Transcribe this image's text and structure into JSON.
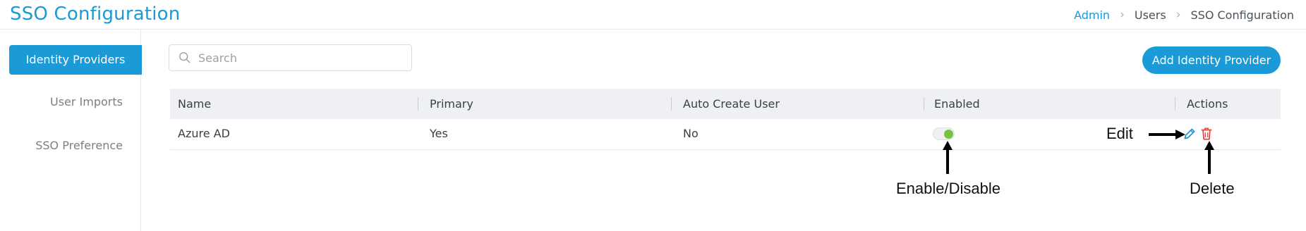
{
  "header": {
    "title": "SSO Configuration",
    "breadcrumb": [
      "Admin",
      "Users",
      "SSO Configuration"
    ]
  },
  "sidebar": {
    "items": [
      {
        "label": "Identity Providers",
        "active": true
      },
      {
        "label": "User Imports",
        "active": false
      },
      {
        "label": "SSO Preference",
        "active": false
      }
    ]
  },
  "search": {
    "placeholder": "Search",
    "value": ""
  },
  "toolbar": {
    "add_label": "Add Identity Provider"
  },
  "table": {
    "columns": [
      "Name",
      "Primary",
      "Auto Create User",
      "Enabled",
      "Actions"
    ],
    "rows": [
      {
        "name": "Azure AD",
        "primary": "Yes",
        "auto_create_user": "No",
        "enabled": true
      }
    ]
  },
  "annotations": {
    "edit": "Edit",
    "enable_disable": "Enable/Disable",
    "delete": "Delete"
  },
  "colors": {
    "accent": "#1a9ad6",
    "toggle_on": "#7ac142",
    "delete": "#e8473f"
  }
}
